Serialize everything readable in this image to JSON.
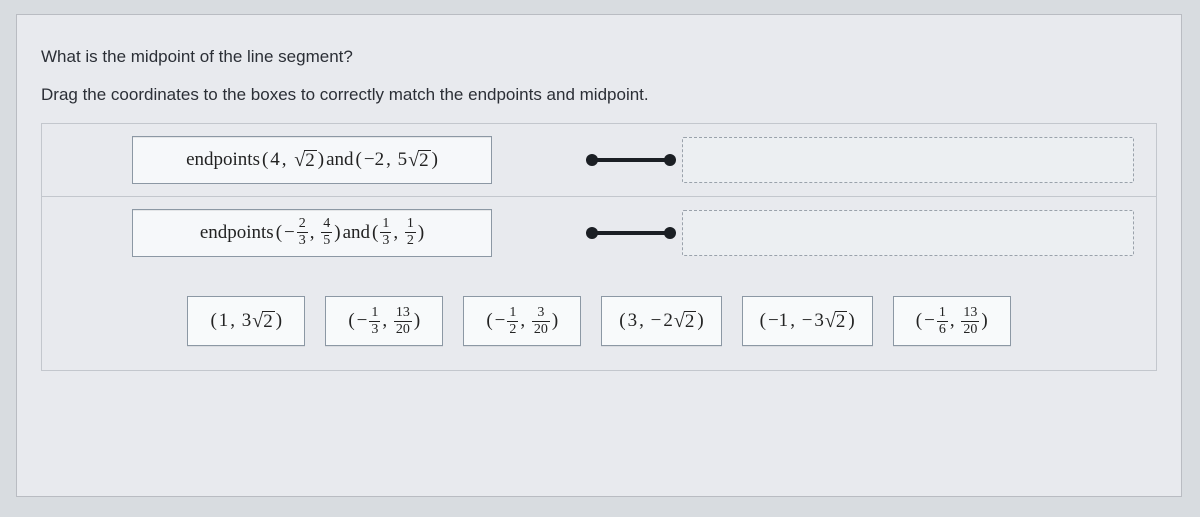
{
  "question": {
    "line1": "What is the midpoint of the line segment?",
    "line2": "Drag the coordinates to the boxes to correctly match the endpoints and midpoint."
  },
  "rows": [
    {
      "label_prefix": "endpoints ",
      "p1": {
        "x_int": "4",
        "y_sqrt_coef": "",
        "y_sqrt_arg": "2"
      },
      "joiner": " and ",
      "p2": {
        "x_int": "−2",
        "y_sqrt_coef": "5",
        "y_sqrt_arg": "2"
      }
    },
    {
      "label_prefix": "endpoints ",
      "p1": {
        "x_frac_sign": "−",
        "x_num": "2",
        "x_den": "3",
        "y_num": "4",
        "y_den": "5"
      },
      "joiner": " and ",
      "p2": {
        "x_num": "1",
        "x_den": "3",
        "y_num": "1",
        "y_den": "2"
      }
    }
  ],
  "tiles": [
    {
      "kind": "sqrt_point",
      "x_int": "1",
      "y_coef": "3",
      "y_arg": "2"
    },
    {
      "kind": "frac_point",
      "x_sign": "−",
      "x_num": "1",
      "x_den": "3",
      "y_num": "13",
      "y_den": "20"
    },
    {
      "kind": "frac_point",
      "x_sign": "−",
      "x_num": "1",
      "x_den": "2",
      "y_num": "3",
      "y_den": "20"
    },
    {
      "kind": "sqrt_point",
      "x_int": "3",
      "y_sign": "−",
      "y_coef": "2",
      "y_arg": "2"
    },
    {
      "kind": "sqrt_point",
      "x_int": "−1",
      "y_sign": "−",
      "y_coef": "3",
      "y_arg": "2"
    },
    {
      "kind": "frac_point",
      "x_sign": "−",
      "x_num": "1",
      "x_den": "6",
      "y_num": "13",
      "y_den": "20"
    }
  ],
  "chart_data": {
    "type": "table",
    "description": "Drag-match: each row of endpoints maps to one midpoint tile.",
    "rows": [
      {
        "endpoints": "(4, √2) and (−2, 5√2)",
        "correct_midpoint": "(1, 3√2)"
      },
      {
        "endpoints": "(−2/3, 4/5) and (1/3, 1/2)",
        "correct_midpoint": "(−1/6, 13/20)"
      }
    ],
    "tile_labels": [
      "(1, 3√2)",
      "(−1/3, 13/20)",
      "(−1/2, 3/20)",
      "(3, −2√2)",
      "(−1, −3√2)",
      "(−1/6, 13/20)"
    ]
  }
}
